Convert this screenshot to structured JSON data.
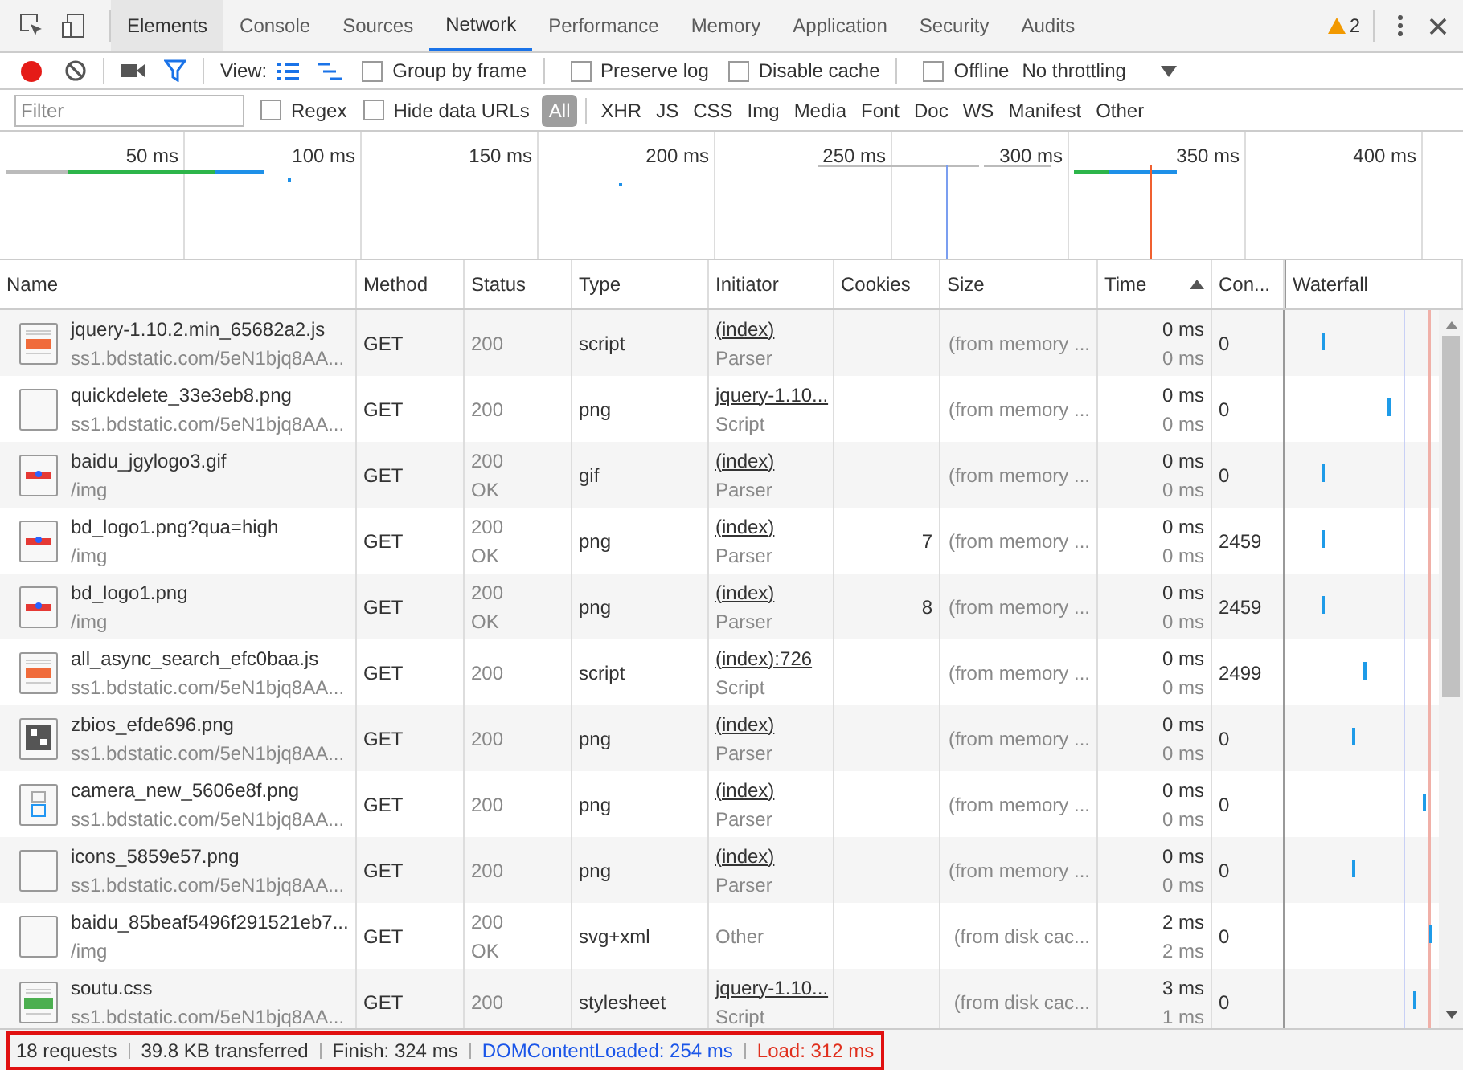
{
  "tabs": [
    {
      "label": "Elements",
      "selected": false
    },
    {
      "label": "Console",
      "selected": false
    },
    {
      "label": "Sources",
      "selected": false
    },
    {
      "label": "Network",
      "selected": true
    },
    {
      "label": "Performance",
      "selected": false
    },
    {
      "label": "Memory",
      "selected": false
    },
    {
      "label": "Application",
      "selected": false
    },
    {
      "label": "Security",
      "selected": false
    },
    {
      "label": "Audits",
      "selected": false
    }
  ],
  "warnings": "2",
  "toolbar": {
    "recording": true,
    "filter_on": true,
    "view_label": "View:",
    "options": [
      {
        "label": "Group by frame",
        "checked": false
      },
      {
        "label": "Preserve log",
        "checked": false
      },
      {
        "label": "Disable cache",
        "checked": false
      },
      {
        "label": "Offline",
        "checked": false
      }
    ],
    "throttling": "No throttling"
  },
  "filter_bar": {
    "placeholder": "Filter",
    "options": [
      {
        "label": "Regex",
        "checked": false
      },
      {
        "label": "Hide data URLs",
        "checked": false
      }
    ],
    "types": [
      {
        "label": "All",
        "selected": true
      },
      {
        "label": "XHR",
        "selected": false
      },
      {
        "label": "JS",
        "selected": false
      },
      {
        "label": "CSS",
        "selected": false
      },
      {
        "label": "Img",
        "selected": false
      },
      {
        "label": "Media",
        "selected": false
      },
      {
        "label": "Font",
        "selected": false
      },
      {
        "label": "Doc",
        "selected": false
      },
      {
        "label": "WS",
        "selected": false
      },
      {
        "label": "Manifest",
        "selected": false
      },
      {
        "label": "Other",
        "selected": false
      }
    ]
  },
  "overview": {
    "ticks": [
      "50 ms",
      "100 ms",
      "150 ms",
      "200 ms",
      "250 ms",
      "300 ms",
      "350 ms",
      "400 ms"
    ]
  },
  "table": {
    "columns": [
      {
        "label": "Name",
        "sorted": false
      },
      {
        "label": "Method",
        "sorted": false
      },
      {
        "label": "Status",
        "sorted": false
      },
      {
        "label": "Type",
        "sorted": false
      },
      {
        "label": "Initiator",
        "sorted": false
      },
      {
        "label": "Cookies",
        "sorted": false
      },
      {
        "label": "Size",
        "sorted": false
      },
      {
        "label": "Time",
        "sorted": true
      },
      {
        "label": "Con...",
        "sorted": false
      },
      {
        "label": "Waterfall",
        "sorted": false
      }
    ],
    "rows": [
      {
        "kind": "script",
        "name": "jquery-1.10.2.min_65682a2.js",
        "path": "ss1.bdstatic.com/5eN1bjq8AA...",
        "method": "GET",
        "status": "200",
        "type": "script",
        "initiator": "(index)",
        "initiator_linked": true,
        "initiator_type": "Parser",
        "size": "(from memory ...",
        "time": "0 ms",
        "latency": "0 ms",
        "content": "0"
      },
      {
        "kind": "blank",
        "name": "quickdelete_33e3eb8.png",
        "path": "ss1.bdstatic.com/5eN1bjq8AA...",
        "method": "GET",
        "status": "200",
        "type": "png",
        "initiator": "jquery-1.10...",
        "initiator_linked": true,
        "initiator_type": "Script",
        "size": "(from memory ...",
        "time": "0 ms",
        "latency": "0 ms",
        "content": "0"
      },
      {
        "kind": "logo",
        "name": "baidu_jgylogo3.gif",
        "path": "/img",
        "method": "GET",
        "status": "200",
        "status_text": "OK",
        "type": "gif",
        "initiator": "(index)",
        "initiator_linked": true,
        "initiator_type": "Parser",
        "size": "(from memory ...",
        "time": "0 ms",
        "latency": "0 ms",
        "content": "0"
      },
      {
        "kind": "logo",
        "name": "bd_logo1.png?qua=high",
        "path": "/img",
        "method": "GET",
        "status": "200",
        "status_text": "OK",
        "type": "png",
        "initiator": "(index)",
        "initiator_linked": true,
        "initiator_type": "Parser",
        "cookies": "7",
        "size": "(from memory ...",
        "time": "0 ms",
        "latency": "0 ms",
        "content": "2459"
      },
      {
        "kind": "logo",
        "name": "bd_logo1.png",
        "path": "/img",
        "method": "GET",
        "status": "200",
        "status_text": "OK",
        "type": "png",
        "initiator": "(index)",
        "initiator_linked": true,
        "initiator_type": "Parser",
        "cookies": "8",
        "size": "(from memory ...",
        "time": "0 ms",
        "latency": "0 ms",
        "content": "2459"
      },
      {
        "kind": "script",
        "name": "all_async_search_efc0baa.js",
        "path": "ss1.bdstatic.com/5eN1bjq8AA...",
        "method": "GET",
        "status": "200",
        "type": "script",
        "initiator": "(index):726",
        "initiator_linked": true,
        "initiator_type": "Script",
        "size": "(from memory ...",
        "time": "0 ms",
        "latency": "0 ms",
        "content": "2499"
      },
      {
        "kind": "qr",
        "name": "zbios_efde696.png",
        "path": "ss1.bdstatic.com/5eN1bjq8AA...",
        "method": "GET",
        "status": "200",
        "type": "png",
        "initiator": "(index)",
        "initiator_linked": true,
        "initiator_type": "Parser",
        "size": "(from memory ...",
        "time": "0 ms",
        "latency": "0 ms",
        "content": "0"
      },
      {
        "kind": "camera",
        "name": "camera_new_5606e8f.png",
        "path": "ss1.bdstatic.com/5eN1bjq8AA...",
        "method": "GET",
        "status": "200",
        "type": "png",
        "initiator": "(index)",
        "initiator_linked": true,
        "initiator_type": "Parser",
        "size": "(from memory ...",
        "time": "0 ms",
        "latency": "0 ms",
        "content": "0"
      },
      {
        "kind": "blank",
        "name": "icons_5859e57.png",
        "path": "ss1.bdstatic.com/5eN1bjq8AA...",
        "method": "GET",
        "status": "200",
        "type": "png",
        "initiator": "(index)",
        "initiator_linked": true,
        "initiator_type": "Parser",
        "size": "(from memory ...",
        "time": "0 ms",
        "latency": "0 ms",
        "content": "0"
      },
      {
        "kind": "blank",
        "name": "baidu_85beaf5496f291521eb7...",
        "path": "/img",
        "method": "GET",
        "status": "200",
        "status_text": "OK",
        "type": "svg+xml",
        "initiator": "Other",
        "initiator_linked": false,
        "size": "(from disk cac...",
        "time": "2 ms",
        "latency": "2 ms",
        "content": "0"
      },
      {
        "kind": "stylesheet",
        "name": "soutu.css",
        "path": "ss1.bdstatic.com/5eN1bjq8AA...",
        "method": "GET",
        "status": "200",
        "type": "stylesheet",
        "initiator": "jquery-1.10...",
        "initiator_linked": true,
        "initiator_type": "Script",
        "size": "(from disk cac...",
        "time": "3 ms",
        "latency": "1 ms",
        "content": "0"
      }
    ]
  },
  "status_bar": {
    "highlighted": true,
    "items": [
      {
        "kind": "plain",
        "text": "18 requests"
      },
      {
        "kind": "plain",
        "text": "39.8 KB transferred"
      },
      {
        "kind": "plain",
        "text": "Finish: 324 ms"
      },
      {
        "kind": "dom",
        "text": "DOMContentLoaded: 254 ms"
      },
      {
        "kind": "load",
        "text": "Load: 312 ms"
      }
    ]
  }
}
